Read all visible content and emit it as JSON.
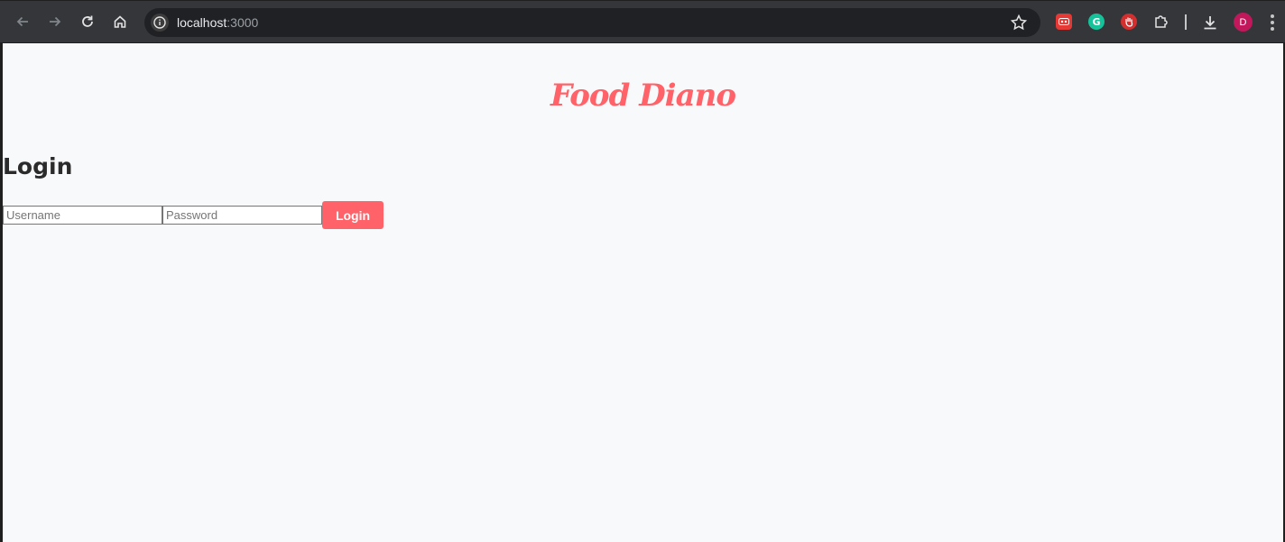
{
  "browser": {
    "url_host": "localhost",
    "url_port": ":3000",
    "avatar_initial": "D",
    "ext_grammarly_letter": "G"
  },
  "app": {
    "brand": "Food Diano",
    "login_heading": "Login",
    "username_placeholder": "Username",
    "username_value": "",
    "password_placeholder": "Password",
    "password_value": "",
    "login_button": "Login"
  },
  "colors": {
    "accent": "#ff6268",
    "page_background": "#f8f9fb",
    "browser_chrome": "#35363a"
  },
  "icons": [
    "back-icon",
    "forward-icon",
    "reload-icon",
    "home-icon",
    "info-icon",
    "star-icon",
    "extension-red-icon",
    "grammarly-icon",
    "stop-hand-icon",
    "puzzle-icon",
    "download-icon",
    "menu-icon"
  ]
}
